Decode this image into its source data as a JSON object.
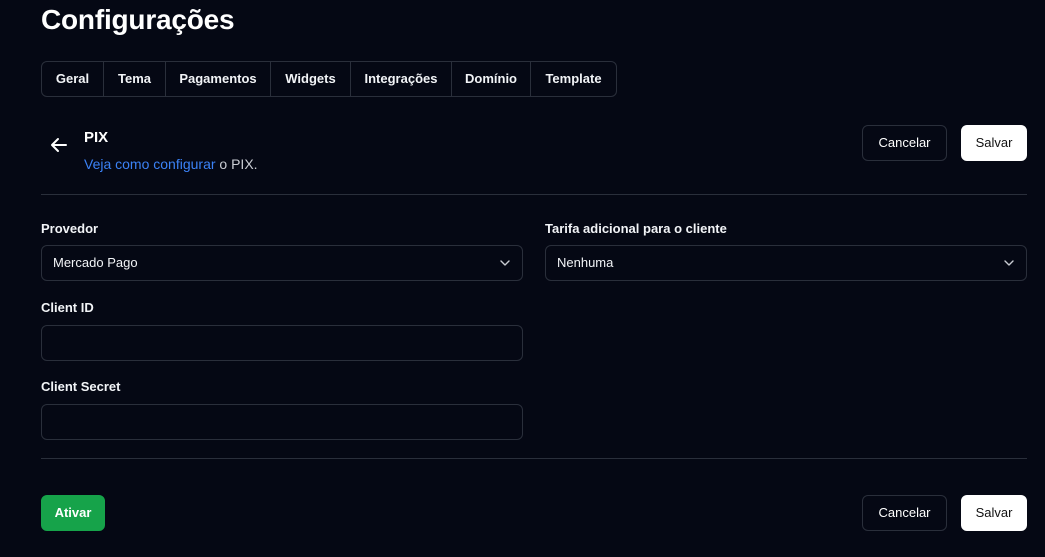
{
  "page": {
    "title": "Configurações"
  },
  "tabs": [
    {
      "label": "Geral"
    },
    {
      "label": "Tema"
    },
    {
      "label": "Pagamentos"
    },
    {
      "label": "Widgets"
    },
    {
      "label": "Integrações"
    },
    {
      "label": "Domínio"
    },
    {
      "label": "Template"
    }
  ],
  "section": {
    "title": "PIX",
    "link_text": "Veja como configurar",
    "suffix_text": " o PIX.",
    "back_icon": "arrow-left-icon"
  },
  "actions": {
    "cancel_label": "Cancelar",
    "save_label": "Salvar",
    "activate_label": "Ativar"
  },
  "form": {
    "provider_label": "Provedor",
    "provider_value": "Mercado Pago",
    "fee_label": "Tarifa adicional para o cliente",
    "fee_value": "Nenhuma",
    "client_id_label": "Client ID",
    "client_id_value": "",
    "client_secret_label": "Client Secret",
    "client_secret_value": ""
  },
  "colors": {
    "background": "#050814",
    "border": "#2a2f3b",
    "link": "#3b82f6",
    "activate": "#16a34a"
  }
}
